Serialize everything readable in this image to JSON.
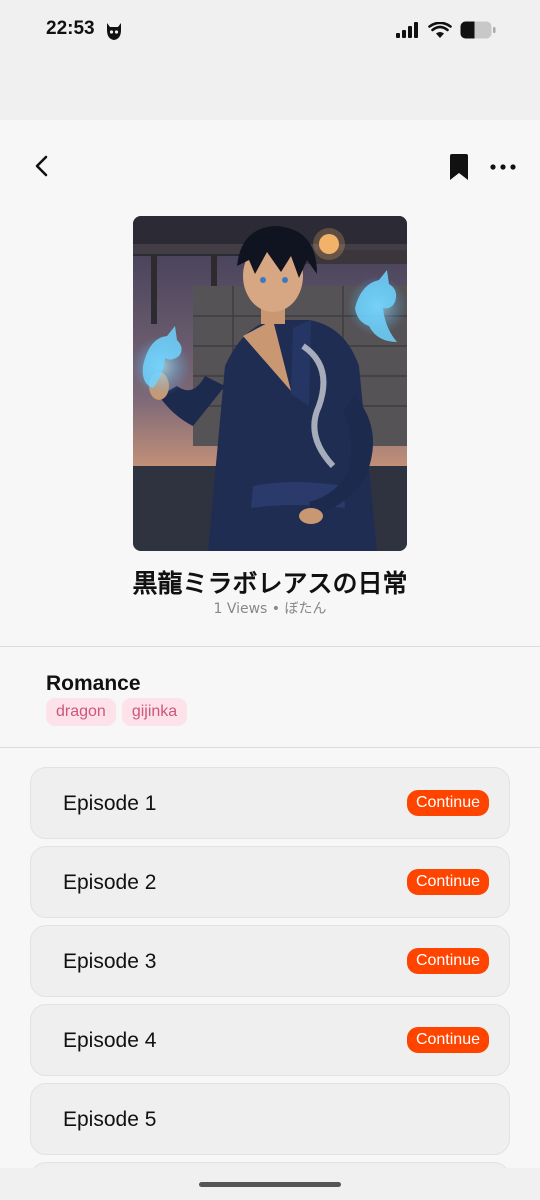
{
  "status_bar": {
    "time": "22:53"
  },
  "book": {
    "title": "黒龍ミラボレアスの日常",
    "meta": "1 Views • ぼたん",
    "genre": "Romance",
    "tags": [
      "dragon",
      "gijinka"
    ]
  },
  "episodes": [
    {
      "label": "Episode 1",
      "action": "Continue"
    },
    {
      "label": "Episode 2",
      "action": "Continue"
    },
    {
      "label": "Episode 3",
      "action": "Continue"
    },
    {
      "label": "Episode 4",
      "action": "Continue"
    },
    {
      "label": "Episode 5",
      "action": ""
    }
  ],
  "colors": {
    "accent": "#ff4400",
    "tag_bg": "#fde2ea",
    "tag_text": "#d0557a"
  },
  "icons": [
    "back-arrow-icon",
    "bookmark-icon",
    "more-icon",
    "cellular-signal-icon",
    "wifi-icon",
    "battery-icon"
  ]
}
